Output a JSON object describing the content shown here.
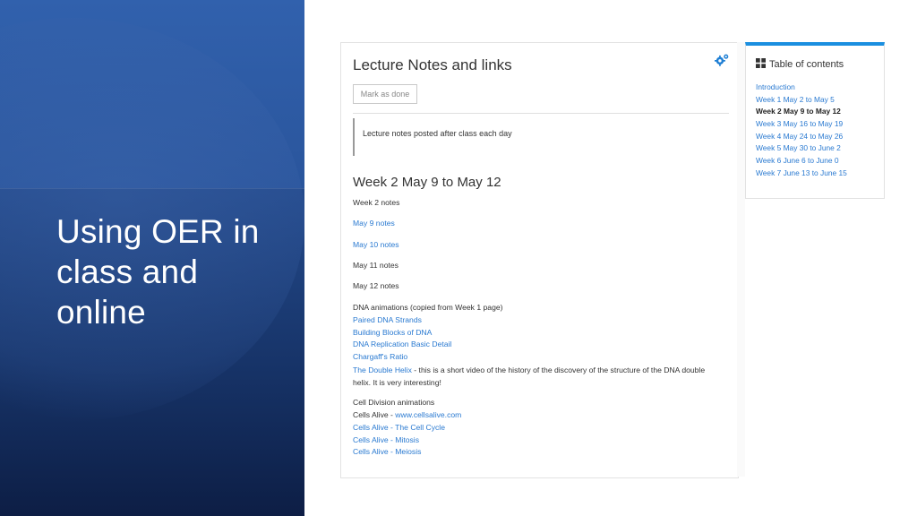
{
  "slide": {
    "title_lines": [
      "Using OER in",
      "class and",
      "online"
    ]
  },
  "content": {
    "title": "Lecture Notes and links",
    "mark_done_label": "Mark as done",
    "note_text": "Lecture notes posted after class each day",
    "week_heading": "Week 2 May 9 to May 12",
    "week_notes_label": "Week 2 notes",
    "notes": [
      "May 9 notes",
      "May 10 notes",
      "May 11 notes",
      "May 12 notes"
    ],
    "dna_heading": "DNA animations (copied from Week 1 page)",
    "dna_links": [
      "Paired DNA Strands",
      "Building Blocks of DNA",
      "DNA Replication Basic Detail",
      "Chargaff's Ratio",
      "The Double Helix"
    ],
    "double_helix_desc": " - this is a short video of the history of the discovery of the structure of the DNA double helix. It is very interesting!",
    "cell_heading": "Cell Division animations",
    "cells_alive_prefix": "Cells Alive - ",
    "cells_alive_url": "www.cellsalive.com",
    "cell_links": [
      "Cells Alive - The Cell Cycle",
      "Cells Alive - Mitosis",
      "Cells Alive - Meiosis"
    ]
  },
  "toc": {
    "title": "Table of contents",
    "items": [
      "Introduction",
      "Week 1 May 2 to May 5",
      "Week 2 May 9 to May 12",
      "Week 3 May 16 to May 19",
      "Week 4 May 24 to May 26",
      "Week 5 May 30 to June 2",
      "Week 6 June 6 to June 0",
      "Week 7 June 13 to June 15"
    ],
    "active_index": 2
  },
  "colors": {
    "link": "#2a7ad1",
    "toc_accent": "#1b8fe0",
    "slide_blue": "#2d5aa2"
  },
  "icons": {
    "settings": "gears-icon",
    "toc": "grid-icon"
  }
}
